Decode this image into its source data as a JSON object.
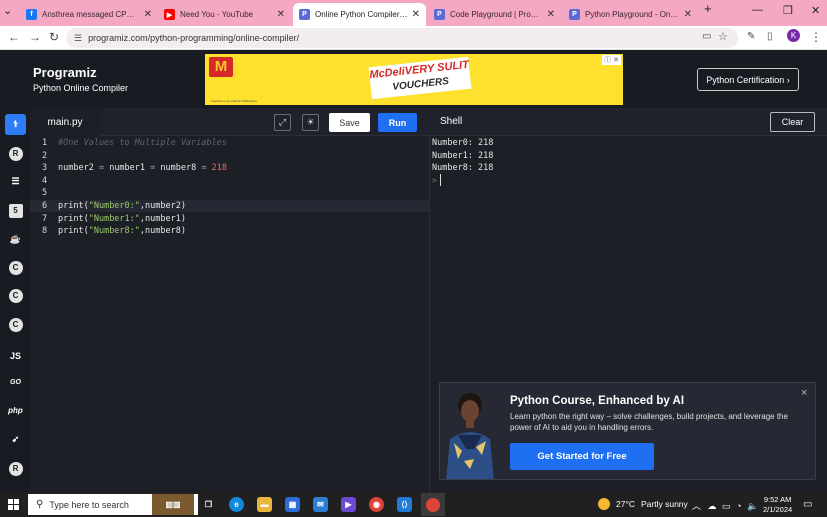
{
  "browser": {
    "tabs": [
      {
        "title": "Ansthrea messaged CPE GROU",
        "favicon": "facebook-icon",
        "color": "#1877f2",
        "glyph": "f"
      },
      {
        "title": "Need You - YouTube",
        "favicon": "youtube-icon",
        "color": "#ff0000",
        "glyph": "▶"
      },
      {
        "title": "Online Python Compiler (Interp",
        "favicon": "programiz-icon",
        "color": "#5b6bd6",
        "glyph": "P"
      },
      {
        "title": "Code Playground | Programiz P",
        "favicon": "programiz-icon",
        "color": "#5b6bd6",
        "glyph": "P"
      },
      {
        "title": "Python Playground - Online Py",
        "favicon": "programiz-icon",
        "color": "#5b6bd6",
        "glyph": "P"
      }
    ],
    "active_tab": 2,
    "new_tab": "+",
    "url": "programiz.com/python-programming/online-compiler/",
    "profile_initial": "K"
  },
  "header": {
    "logo": "Programiz",
    "subtitle": "Python Online Compiler",
    "cert_button": "Python Certification ›",
    "ad": {
      "brand": "M",
      "line1": "McDeliVERY SULIT",
      "line2": "VOUCHERS",
      "fine": "Vouchers only valid for McDelivery"
    }
  },
  "sidebar": {
    "items": [
      {
        "name": "python",
        "glyph": "🐍"
      },
      {
        "name": "r",
        "glyph": "R"
      },
      {
        "name": "sql",
        "glyph": "≡"
      },
      {
        "name": "html",
        "glyph": "5"
      },
      {
        "name": "java",
        "glyph": "☕"
      },
      {
        "name": "c",
        "glyph": "C"
      },
      {
        "name": "cpp",
        "glyph": "C"
      },
      {
        "name": "csharp",
        "glyph": "C"
      },
      {
        "name": "js",
        "glyph": "JS"
      },
      {
        "name": "go",
        "glyph": "GO"
      },
      {
        "name": "php",
        "glyph": "php"
      },
      {
        "name": "swift",
        "glyph": "➹"
      },
      {
        "name": "rust",
        "glyph": "R"
      }
    ]
  },
  "editor": {
    "file_name": "main.py",
    "save_label": "Save",
    "run_label": "Run",
    "lines": [
      {
        "n": "1",
        "text": "#One Values to Multiple Variables"
      },
      {
        "n": "2",
        "text": ""
      },
      {
        "n": "3",
        "text": "number2 = number1 = number8 = 218"
      },
      {
        "n": "4",
        "text": ""
      },
      {
        "n": "5",
        "text": ""
      },
      {
        "n": "6",
        "text": "print(\"Number0:\",number2)"
      },
      {
        "n": "7",
        "text": "print(\"Number1:\",number1)"
      },
      {
        "n": "8",
        "text": "print(\"Number8:\",number8)"
      }
    ]
  },
  "shell": {
    "title": "Shell",
    "clear_label": "Clear",
    "output": [
      "Number0: 218",
      "Number1: 218",
      "Number8: 218"
    ],
    "prompt": ">"
  },
  "promo": {
    "title": "Python Course, Enhanced by AI",
    "text": "Learn python the right way – solve challenges, build projects, and leverage the power of AI to aid you in handling errors.",
    "button": "Get Started for Free",
    "close": "×"
  },
  "taskbar": {
    "search_placeholder": "Type here to search",
    "weather_temp": "27°C",
    "weather_desc": "Partly sunny",
    "time": "9:52 AM",
    "date": "2/1/2024"
  }
}
